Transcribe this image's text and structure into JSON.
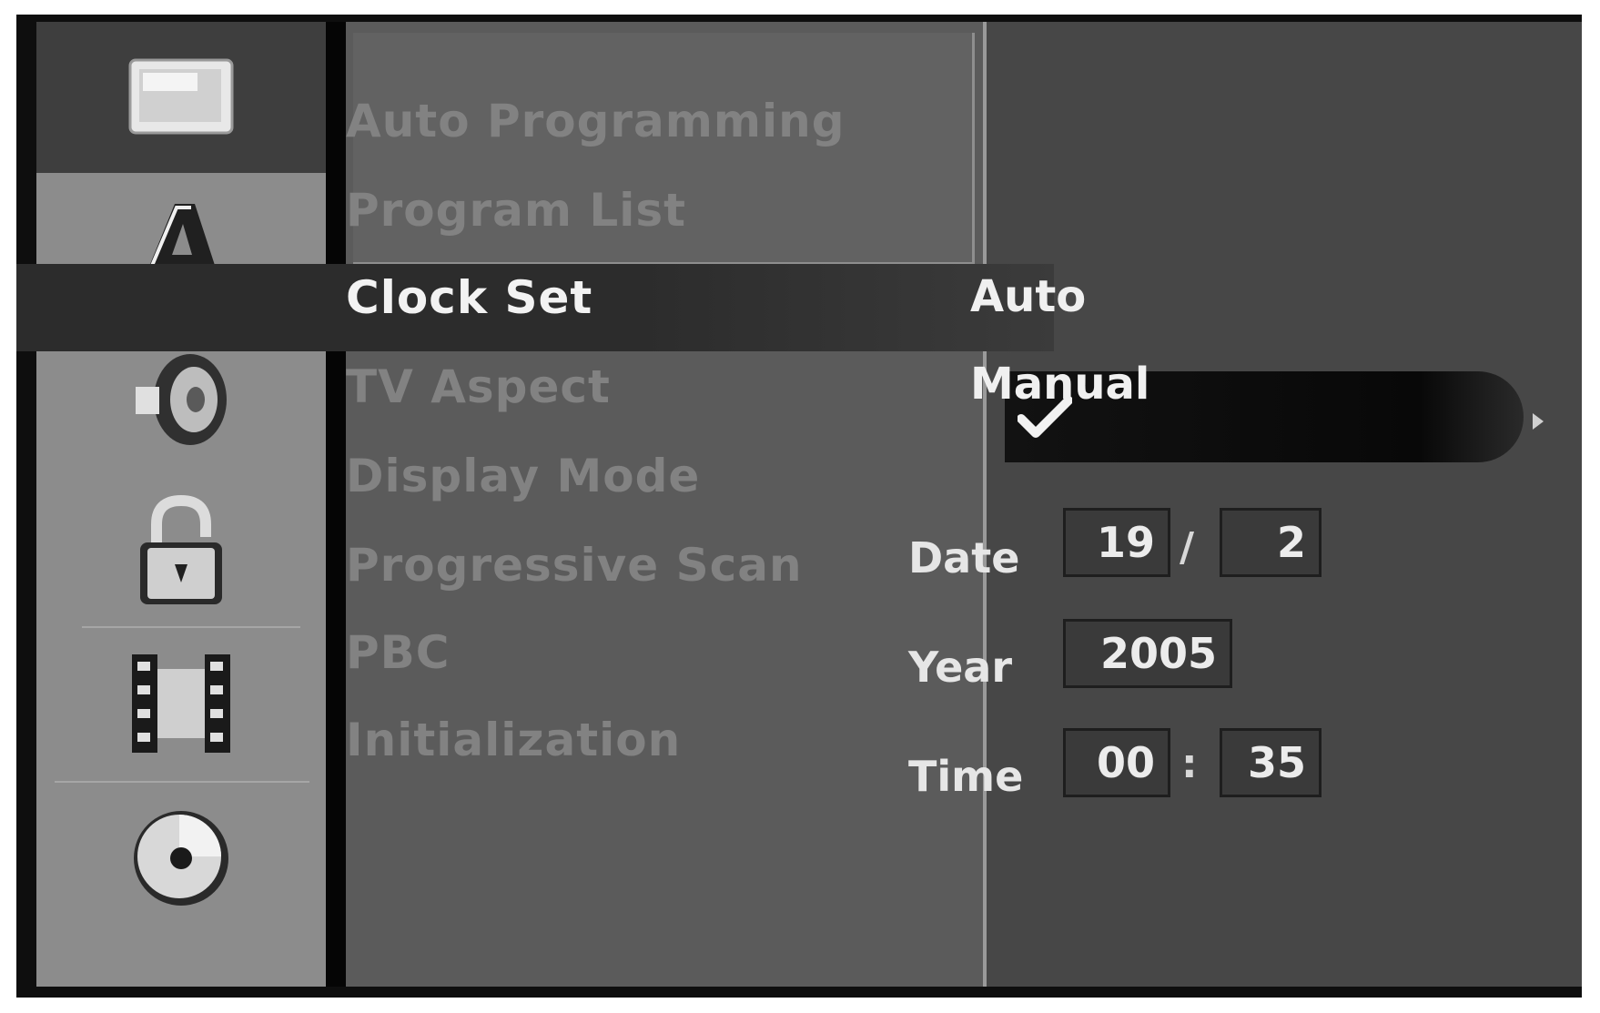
{
  "sidebar": {
    "items": [
      {
        "icon": "tv-screen-icon",
        "active": true
      },
      {
        "icon": "language-a-icon",
        "active": false
      },
      {
        "icon": "speaker-icon",
        "active": false
      },
      {
        "icon": "padlock-icon",
        "active": false
      },
      {
        "icon": "film-icon",
        "active": false
      },
      {
        "icon": "disc-icon",
        "active": false
      }
    ]
  },
  "menu": {
    "items": [
      {
        "label": "Auto Programming",
        "selected": false
      },
      {
        "label": "Program List",
        "selected": false
      },
      {
        "label": "Clock Set",
        "selected": true
      },
      {
        "label": "TV Aspect",
        "selected": false
      },
      {
        "label": "Display Mode",
        "selected": false
      },
      {
        "label": "Progressive Scan",
        "selected": false
      },
      {
        "label": "PBC",
        "selected": false
      },
      {
        "label": "Initialization",
        "selected": false
      }
    ]
  },
  "clock": {
    "options": {
      "auto": "Auto",
      "manual": "Manual"
    },
    "selected_option": "Manual",
    "date_label": "Date",
    "date_day": "19",
    "date_separator": "/",
    "date_month": "2",
    "year_label": "Year",
    "year_value": "2005",
    "time_label": "Time",
    "time_hour": "00",
    "time_separator": ":",
    "time_minute": "35"
  },
  "colors": {
    "osd_background": "#0e0e0e",
    "sidebar": "#8c8c8c",
    "menu_panel": "#5b5b5b",
    "right_panel": "#474747",
    "highlight_bar": "#080808"
  }
}
